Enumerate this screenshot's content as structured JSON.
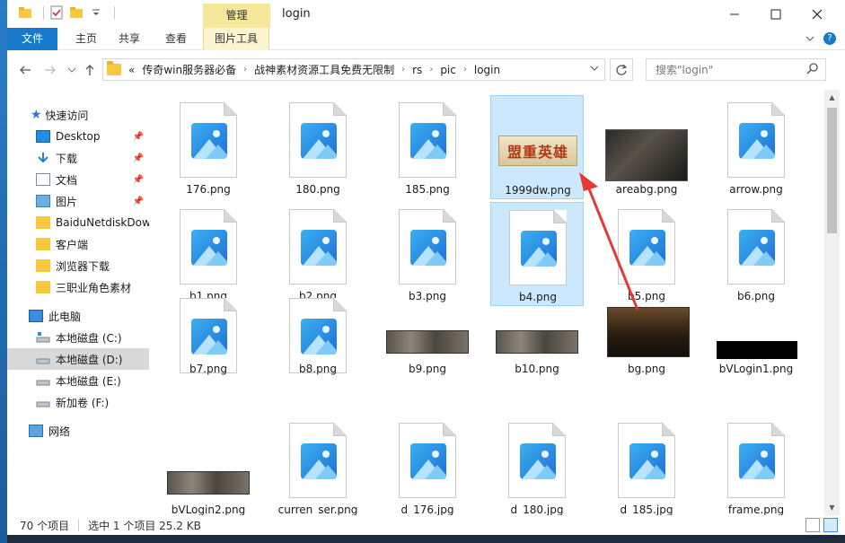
{
  "window": {
    "title": "login",
    "manage_tab": "管理",
    "controls": {
      "minimize": "—",
      "maximize": "☐",
      "close": "✕"
    }
  },
  "ribbon": {
    "tabs": [
      "文件",
      "主页",
      "共享",
      "查看",
      "图片工具"
    ],
    "help": "?"
  },
  "address": {
    "overflow": "«",
    "crumbs": [
      "传奇win服务器必备",
      "战神素材资源工具免费无限制",
      "rs",
      "pic",
      "login"
    ],
    "search_placeholder": "搜索\"login\""
  },
  "nav": {
    "quick_access": "快速访问",
    "items": [
      {
        "label": "Desktop",
        "pinned": true
      },
      {
        "label": "下载",
        "pinned": true
      },
      {
        "label": "文档",
        "pinned": true
      },
      {
        "label": "图片",
        "pinned": true
      },
      {
        "label": "BaiduNetdiskDow"
      },
      {
        "label": "客户端"
      },
      {
        "label": "浏览器下载"
      },
      {
        "label": "三职业角色素材"
      }
    ],
    "this_pc": "此电脑",
    "drives": [
      "本地磁盘 (C:)",
      "本地磁盘 (D:)",
      "本地磁盘 (E:)",
      "新加卷 (F:)"
    ],
    "network": "网络"
  },
  "files": [
    {
      "name": "176.png",
      "kind": "icon"
    },
    {
      "name": "180.png",
      "kind": "icon"
    },
    {
      "name": "185.png",
      "kind": "icon"
    },
    {
      "name": "1999dw.png",
      "kind": "logo",
      "selected": true,
      "logo_text": "盟重英雄"
    },
    {
      "name": "areabg.png",
      "kind": "dark-panel"
    },
    {
      "name": "arrow.png",
      "kind": "icon"
    },
    {
      "name": "b1.png",
      "kind": "icon"
    },
    {
      "name": "b2.png",
      "kind": "icon"
    },
    {
      "name": "b3.png",
      "kind": "icon"
    },
    {
      "name": "b4.png",
      "kind": "icon",
      "selected": true
    },
    {
      "name": "b5.png",
      "kind": "icon"
    },
    {
      "name": "b6.png",
      "kind": "icon"
    },
    {
      "name": "b7.png",
      "kind": "icon"
    },
    {
      "name": "b8.png",
      "kind": "icon"
    },
    {
      "name": "b9.png",
      "kind": "stone-bar"
    },
    {
      "name": "b10.png",
      "kind": "stone-bar"
    },
    {
      "name": "bg.png",
      "kind": "scene"
    },
    {
      "name": "bVLogin1.png",
      "kind": "black-bar"
    },
    {
      "name": "bVLogin2.png",
      "kind": "stone-bar"
    },
    {
      "name": "curren_ser.png",
      "kind": "icon"
    },
    {
      "name": "d_176.jpg",
      "kind": "icon"
    },
    {
      "name": "d_180.jpg",
      "kind": "icon"
    },
    {
      "name": "d_185.jpg",
      "kind": "icon"
    },
    {
      "name": "frame.png",
      "kind": "icon"
    }
  ],
  "status": {
    "count": "70 个项目",
    "selection": "选中 1 个项目  25.2 KB"
  },
  "colors": {
    "accent": "#1979ca",
    "selection": "#cce8ff",
    "manage": "#f5e89c",
    "annotation_arrow": "#e53935"
  }
}
